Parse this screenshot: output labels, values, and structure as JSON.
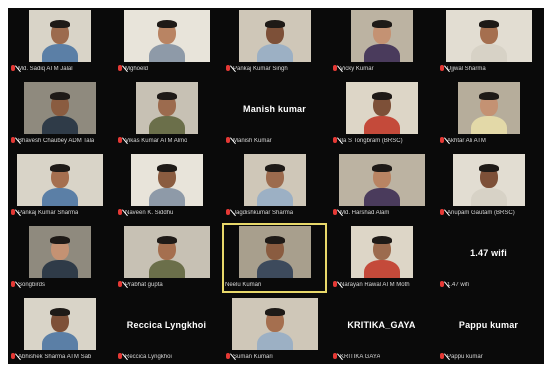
{
  "meeting": {
    "colors": {
      "background": "#0a0a0a",
      "active_speaker": "#e8d86a",
      "mute_icon": "#e53935",
      "label_text": "#d8d8d8"
    },
    "participants": [
      {
        "name": "Md. Sadiq ATM Jalal",
        "video": true,
        "muted": true
      },
      {
        "name": "Mghoeld",
        "video": true,
        "muted": true
      },
      {
        "name": "Pankaj Kumar Singh",
        "video": true,
        "muted": true
      },
      {
        "name": "Vicky Kumar",
        "video": true,
        "muted": true
      },
      {
        "name": "Ujjwal Sharma",
        "video": true,
        "muted": true
      },
      {
        "name": "Bhavesh Chaubey ADM Tala",
        "video": true,
        "muted": true
      },
      {
        "name": "Vikas Kumar ATM Almo",
        "video": true,
        "muted": true
      },
      {
        "name": "Manish Kumar",
        "video": false,
        "muted": true,
        "center_name": "Manish kumar"
      },
      {
        "name": "Ila S Tongbram (BRSC)",
        "video": true,
        "muted": true
      },
      {
        "name": "Akhtar Ali ATM",
        "video": true,
        "muted": true
      },
      {
        "name": "Pankaj Kumar Sharma",
        "video": true,
        "muted": true
      },
      {
        "name": "Naveen K. Siddhu",
        "video": true,
        "muted": true
      },
      {
        "name": "Jagdishkumar Sharma",
        "video": true,
        "muted": true
      },
      {
        "name": "Md. Harshad Alam",
        "video": true,
        "muted": true
      },
      {
        "name": "Anupam Gautam (BRSC)",
        "video": true,
        "muted": true
      },
      {
        "name": "Songbirds",
        "video": true,
        "muted": true
      },
      {
        "name": "Prabhat gupta",
        "video": true,
        "muted": true
      },
      {
        "name": "Neelu Kumari",
        "video": true,
        "muted": false,
        "active": true
      },
      {
        "name": "Narayan Rawal ATM Moth",
        "video": true,
        "muted": true
      },
      {
        "name": "1.47 wifi",
        "video": false,
        "muted": true,
        "center_name": "1.47 wifi"
      },
      {
        "name": "Abhishek Sharma ATM Sab",
        "video": true,
        "muted": true
      },
      {
        "name": "Reccica Lyngkhoi",
        "video": false,
        "muted": true,
        "center_name": "Reccica Lyngkhoi"
      },
      {
        "name": "Suman Kumari",
        "video": true,
        "muted": true
      },
      {
        "name": "KRITIKA GAYA",
        "video": false,
        "muted": true,
        "center_name": "KRITIKA_GAYA"
      },
      {
        "name": "Pappu kumar",
        "video": false,
        "muted": true,
        "center_name": "Pappu kumar"
      }
    ]
  }
}
